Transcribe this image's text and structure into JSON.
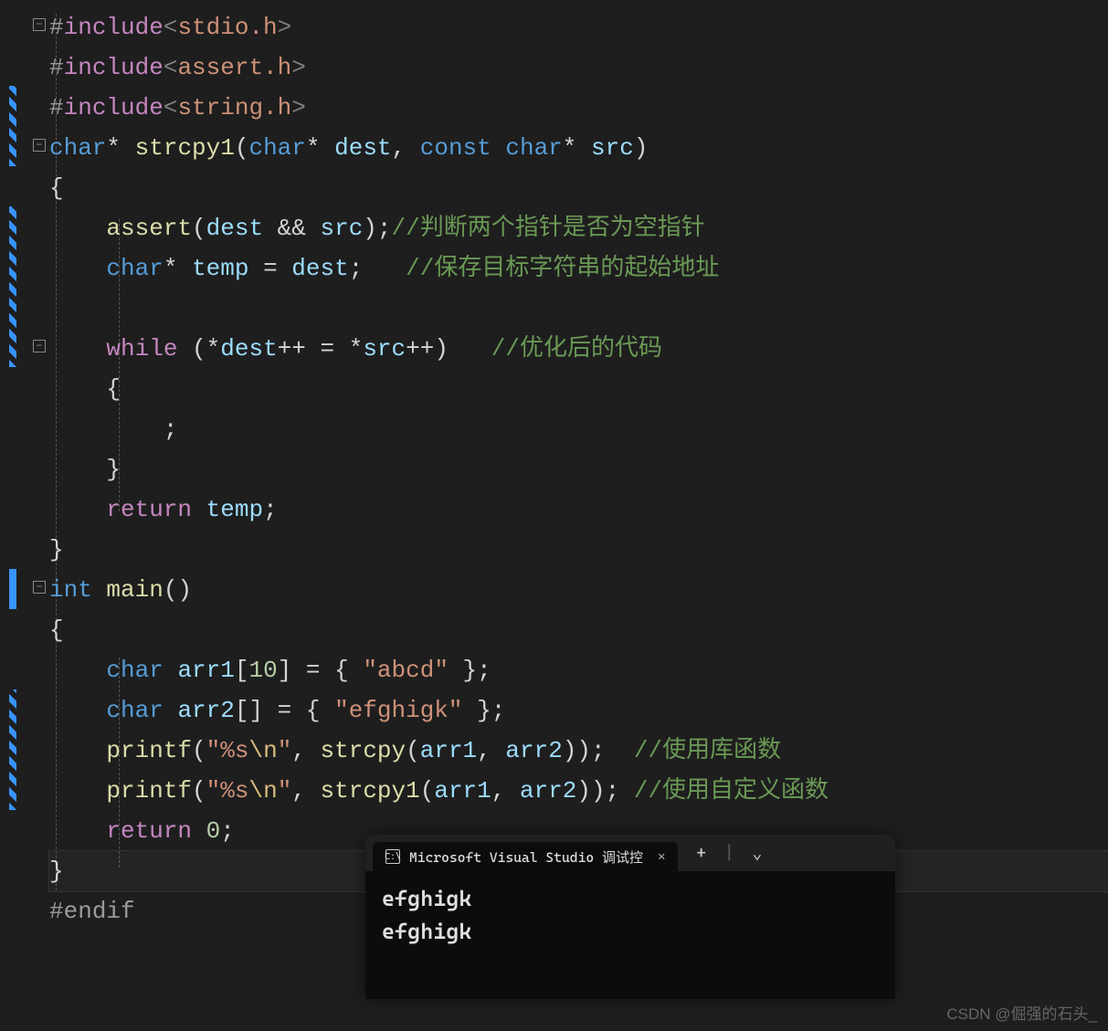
{
  "code": {
    "line1": {
      "hash": "#",
      "inc": "include",
      "lt": "<",
      "hdr": "stdio.h",
      "gt": ">"
    },
    "line2": {
      "hash": "#",
      "inc": "include",
      "lt": "<",
      "hdr": "assert.h",
      "gt": ">"
    },
    "line3": {
      "hash": "#",
      "inc": "include",
      "lt": "<",
      "hdr": "string.h",
      "gt": ">"
    },
    "line4": {
      "t1": "char",
      "star": "* ",
      "fn": "strcpy1",
      "lp": "(",
      "t2": "char",
      "star2": "* ",
      "p1": "dest",
      "comma": ", ",
      "const": "const ",
      "t3": "char",
      "star3": "* ",
      "p2": "src",
      "rp": ")"
    },
    "line5": "{",
    "line6": {
      "fn": "assert",
      "lp": "(",
      "p1": "dest ",
      "op": "&& ",
      "p2": "src",
      "rp": ")",
      "semi": ";",
      "comment": "//判断两个指针是否为空指针"
    },
    "line7": {
      "t": "char",
      "star": "* ",
      "var": "temp ",
      "eq": "= ",
      "p": "dest",
      "semi": ";",
      "sp": "   ",
      "comment": "//保存目标字符串的起始地址"
    },
    "line8": "",
    "line9": {
      "kw": "while ",
      "lp": "(",
      "op1": "*",
      "p1": "dest",
      "op2": "++ = *",
      "p2": "src",
      "op3": "++",
      "rp": ")",
      "sp": "   ",
      "comment": "//优化后的代码"
    },
    "line10": "{",
    "line11": ";",
    "line12": "}",
    "line13": {
      "kw": "return ",
      "var": "temp",
      "semi": ";"
    },
    "line14": "}",
    "line15": {
      "t": "int ",
      "fn": "main",
      "lp": "(",
      "rp": ")"
    },
    "line16": "{",
    "line17": {
      "t": "char ",
      "var": "arr1",
      "lb": "[",
      "num": "10",
      "rb": "] ",
      "eq": "= { ",
      "str": "\"abcd\"",
      "end": " };"
    },
    "line18": {
      "t": "char ",
      "var": "arr2",
      "lb": "[]",
      "eq": " = { ",
      "str": "\"efghigk\"",
      "end": " };"
    },
    "line19": {
      "fn": "printf",
      "lp": "(",
      "str": "\"%s",
      "esc": "\\n",
      "str2": "\"",
      "comma": ", ",
      "fn2": "strcpy",
      "lp2": "(",
      "a1": "arr1",
      "c2": ", ",
      "a2": "arr2",
      "rp2": "))",
      "semi": ";",
      "sp": "  ",
      "comment": "//使用库函数"
    },
    "line20": {
      "fn": "printf",
      "lp": "(",
      "str": "\"%s",
      "esc": "\\n",
      "str2": "\"",
      "comma": ", ",
      "fn2": "strcpy1",
      "lp2": "(",
      "a1": "arr1",
      "c2": ", ",
      "a2": "arr2",
      "rp2": "))",
      "semi": ";",
      "sp": " ",
      "comment": "//使用自定义函数"
    },
    "line21": {
      "kw": "return ",
      "num": "0",
      "semi": ";"
    },
    "line22": "}",
    "line23": {
      "hash": "#",
      "txt": "endif"
    }
  },
  "terminal": {
    "tab_title": "Microsoft Visual Studio 调试控",
    "output_line1": "efghigk",
    "output_line2": "efghigk",
    "plus": "+",
    "chevron": "⌄"
  },
  "watermark": "CSDN @倔强的石头_"
}
